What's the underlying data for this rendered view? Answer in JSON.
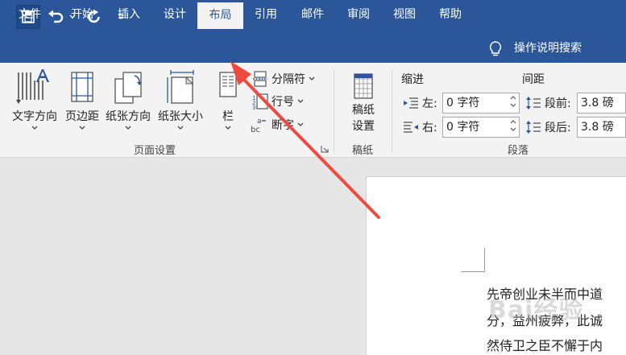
{
  "quick_access": {
    "save_icon": "save-icon",
    "undo_icon": "undo-icon",
    "redo_icon": "redo-icon",
    "customize_icon": "customize-quick-access-icon"
  },
  "tabs": [
    {
      "label": "文件"
    },
    {
      "label": "开始"
    },
    {
      "label": "插入"
    },
    {
      "label": "设计"
    },
    {
      "label": "布局"
    },
    {
      "label": "引用"
    },
    {
      "label": "邮件"
    },
    {
      "label": "审阅"
    },
    {
      "label": "视图"
    },
    {
      "label": "帮助"
    }
  ],
  "tell_me": {
    "label": "操作说明搜索"
  },
  "ribbon": {
    "page_setup": {
      "text_direction": "文字方向",
      "margins": "页边距",
      "orientation": "纸张方向",
      "size": "纸张大小",
      "columns": "栏",
      "breaks": "分隔符",
      "line_numbers": "行号",
      "hyphenation": "断字",
      "group_label": "页面设置"
    },
    "manuscript": {
      "settings_line1": "稿纸",
      "settings_line2": "设置",
      "group_label": "稿纸"
    },
    "paragraph": {
      "indent_header": "缩进",
      "spacing_header": "间距",
      "indent_left_label": "左:",
      "indent_left_value": "0 字符",
      "indent_right_label": "右:",
      "indent_right_value": "0 字符",
      "spacing_before_label": "段前:",
      "spacing_before_value": "3.8 磅",
      "spacing_after_label": "段后:",
      "spacing_after_value": "3.8 磅",
      "group_label": "段落"
    }
  },
  "document": {
    "lines": [
      "先帝创业未半而中道",
      "分，益州疲弊，此诚",
      "然侍卫之臣不懈于内"
    ],
    "watermark": "Bai经验"
  },
  "colors": {
    "titlebar": "#2b579a",
    "ribbon": "#f3f3f3",
    "annotation_arrow": "#f04a3f"
  }
}
